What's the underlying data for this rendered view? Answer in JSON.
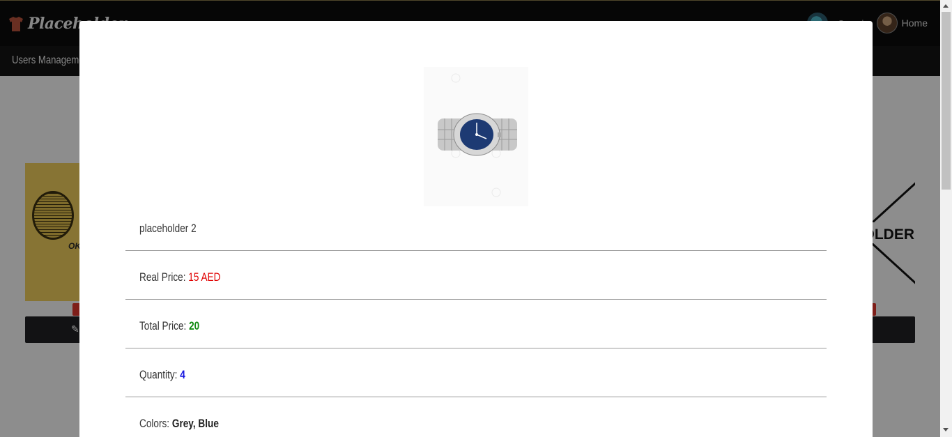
{
  "header": {
    "brand_text": "Placeholder",
    "search_text": "Search",
    "home_label": "Home"
  },
  "nav": {
    "users_management": "Users Management"
  },
  "modal": {
    "product_name": "placeholder 2",
    "real_price_label": "Real Price:",
    "real_price_value": "15 AED",
    "total_price_label": "Total Price:",
    "total_price_value": "20",
    "quantity_label": "Quantity:",
    "quantity_value": "4",
    "colors_label": "Colors:",
    "colors_value": "Grey, Blue",
    "image": {
      "alt": "silver wristwatch with blue dial"
    }
  },
  "background_cards": {
    "right_image_text": "OLDER"
  },
  "colors": {
    "topbar": "#0b0b0b",
    "navbar": "#141414",
    "real_price": "#e00000",
    "total_price": "#118a11",
    "quantity": "#1515e0",
    "badge": "#d9342b"
  },
  "icons": [
    "tshirt-logo-icon",
    "pencil-icon",
    "search-avatar-icon",
    "user-avatar-icon"
  ]
}
